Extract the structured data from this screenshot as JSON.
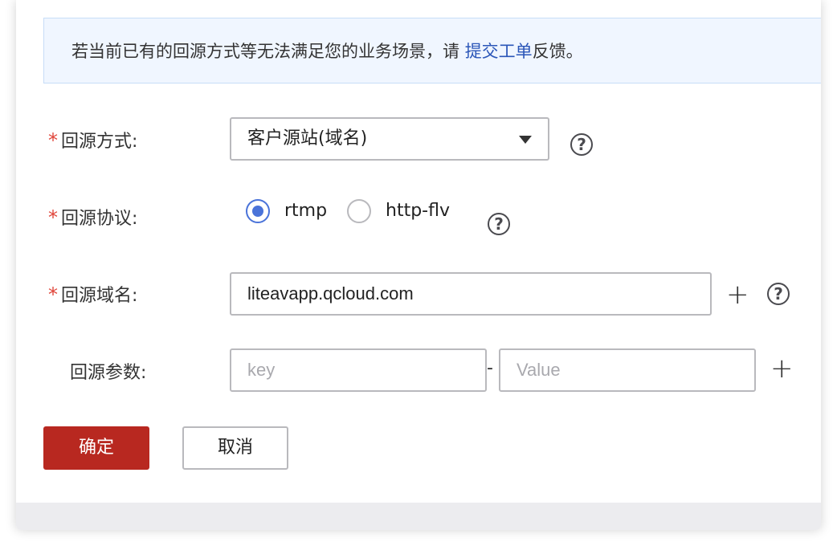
{
  "notice": {
    "text_before": "若当前已有的回源方式等无法满足您的业务场景，请 ",
    "link": "提交工单",
    "text_after": "反馈。"
  },
  "form": {
    "required_mark": "*",
    "origin_type": {
      "label": "回源方式:",
      "value": "客户源站(域名)"
    },
    "origin_protocol": {
      "label": "回源协议:",
      "options": [
        {
          "label": "rtmp",
          "checked": true
        },
        {
          "label": "http-flv",
          "checked": false
        }
      ]
    },
    "origin_domain": {
      "label": "回源域名:",
      "value": "liteavapp.qcloud.com"
    },
    "origin_params": {
      "label": "回源参数:",
      "key_placeholder": "key",
      "separator": "-",
      "value_placeholder": "Value"
    },
    "help_symbol": "?",
    "add_symbol": "+"
  },
  "buttons": {
    "confirm": "确定",
    "cancel": "取消"
  },
  "colors": {
    "primary": "#b82820",
    "link": "#2b56b8",
    "radio_checked": "#4a73d9",
    "required": "#e0453a"
  }
}
